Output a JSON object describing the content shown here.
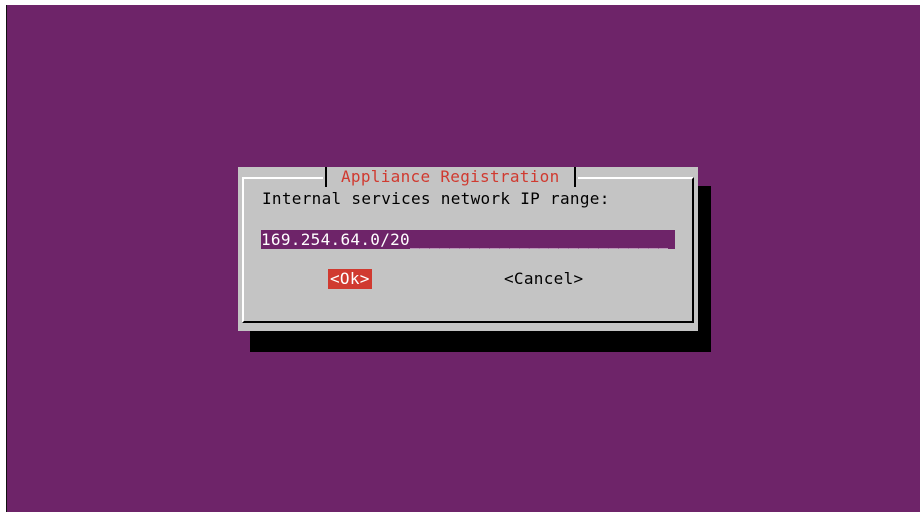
{
  "dialog": {
    "title": "Appliance Registration",
    "prompt": "Internal services network IP range:",
    "input_value": "169.254.64.0/20",
    "input_fill": "__________________________",
    "ok_label": "<Ok>",
    "cancel_label": "<Cancel>"
  },
  "colors": {
    "background": "#6e2469",
    "dialog_bg": "#c4c4c4",
    "title_text": "#d03a30",
    "selected_button_bg": "#d03a30",
    "input_bg": "#6e2469"
  }
}
